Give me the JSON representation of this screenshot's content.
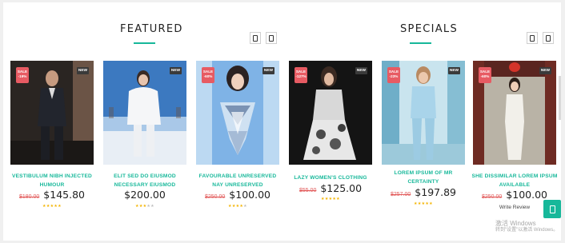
{
  "sections": {
    "featured": {
      "title": "FEATURED"
    },
    "specials": {
      "title": "SPECIALS"
    }
  },
  "accent_color": "#17b89a",
  "sale_color": "#e75b63",
  "star_color": "#f4b400",
  "products": [
    {
      "badge_sale": "SALE -19%",
      "badge_sale_line1": "SALE",
      "badge_sale_line2": "-19%",
      "badge_new": "NEW",
      "name": "VESTIBULUM NIBH INJECTED HUMOUR",
      "old_price": "$180.00",
      "price": "$145.80",
      "rating": 5
    },
    {
      "badge_new": "NEW",
      "name": "ELIT SED DO EIUSMOD NECESSARY EIUSMOD",
      "old_price": "",
      "price": "$200.00",
      "rating": 3
    },
    {
      "badge_sale_line1": "SALE",
      "badge_sale_line2": "-60%",
      "badge_new": "NEW",
      "name": "FAVOURABLE UNRESERVED NAY UNRESERVED",
      "old_price": "$250.00",
      "price": "$100.00",
      "rating": 4
    },
    {
      "badge_sale_line1": "SALE",
      "badge_sale_line2": "-127%",
      "badge_new": "NEW",
      "name": "LAZY WOMEN'S CLOTHING",
      "old_price": "$55.00",
      "price": "$125.00",
      "rating": 5
    },
    {
      "badge_sale_line1": "SALE",
      "badge_sale_line2": "-23%",
      "badge_new": "NEW",
      "name": "LOREM IPSUM OF MR CERTAINTY",
      "old_price": "$257.00",
      "price": "$197.89",
      "rating": 5
    },
    {
      "badge_sale_line1": "SALE",
      "badge_sale_line2": "-60%",
      "badge_new": "NEW",
      "name": "SHE DISSIMILAR LOREM IPSUM AVAILABLE",
      "old_price": "$250.00",
      "price": "$100.00",
      "rating": 0,
      "review_label": "Write Review"
    }
  ],
  "watermark": {
    "line1": "激活 Windows",
    "line2": "转到\"设置\"以激活 Windows。"
  },
  "icons": {
    "nav_prev": "phone-icon",
    "nav_next": "phone-icon",
    "fab": "phone-icon"
  }
}
